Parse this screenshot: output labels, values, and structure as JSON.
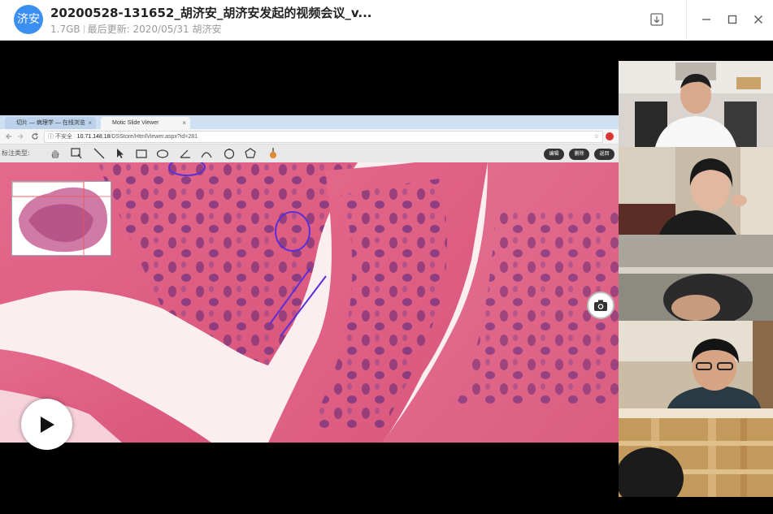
{
  "app": {
    "logo_text": "济安",
    "title": "20200528-131652_胡济安_胡济安发起的视频会议_v...",
    "file_size": "1.7GB",
    "last_updated": "最后更新: 2020/05/31 胡济安"
  },
  "window_controls": [
    "download-icon",
    "minimize-icon",
    "maximize-icon",
    "close-icon"
  ],
  "shared_screen": {
    "browser": {
      "tabs": [
        {
          "label": "切片 — 病理学 — 在线浏览"
        },
        {
          "label": "Motic Slide Viewer"
        }
      ],
      "security_label": "不安全",
      "address_host": "10.71.148.18",
      "address_path": "/DSStore/HtmlViewer.aspx?id=281"
    },
    "viewer_toolbar": {
      "label": "标注类型:",
      "tools": [
        "hand-icon",
        "select-rect-icon",
        "line-icon",
        "arrow-icon",
        "rectangle-icon",
        "ellipse-icon",
        "angle-icon",
        "arc-icon",
        "circle-icon",
        "polygon-icon",
        "marker-icon"
      ],
      "buttons": [
        "编辑",
        "删除",
        "返回"
      ]
    }
  },
  "participants": [
    {
      "name": "participant-1"
    },
    {
      "name": "participant-2"
    },
    {
      "name": "participant-3"
    },
    {
      "name": "participant-4"
    },
    {
      "name": "participant-5"
    }
  ],
  "controls": {
    "play_icon": "play-icon",
    "snapshot_icon": "camera-icon"
  }
}
